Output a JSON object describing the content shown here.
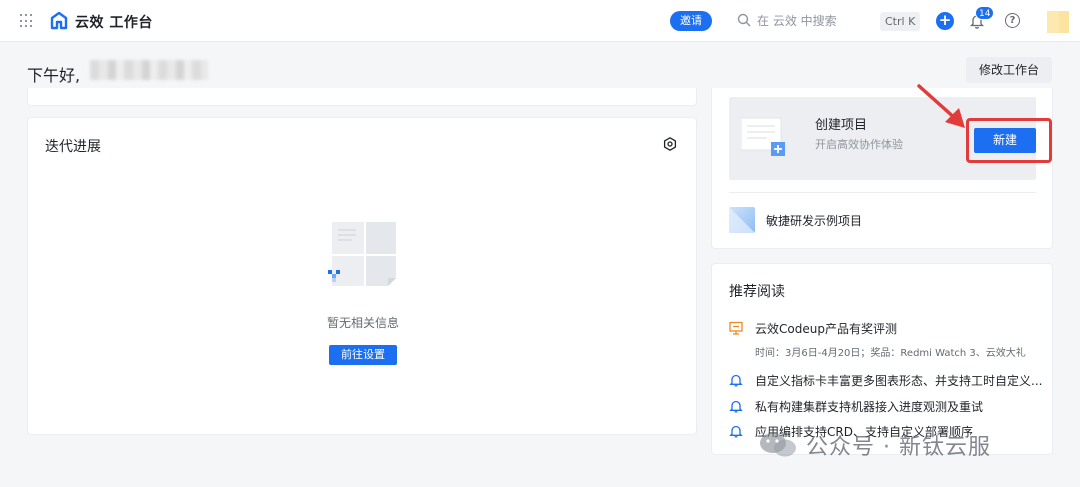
{
  "topbar": {
    "app_title": "云效 工作台",
    "invite_label": "邀请",
    "search_placeholder": "在 云效 中搜索",
    "shortcut": "Ctrl K",
    "notification_count": "14",
    "help_glyph": "?",
    "add_glyph": "+"
  },
  "greeting": {
    "text": "下午好,"
  },
  "edit_workbench_label": "修改工作台",
  "iteration_card": {
    "title": "迭代进展",
    "empty_text": "暂无相关信息",
    "goto_label": "前往设置"
  },
  "create_project": {
    "title": "创建项目",
    "subtitle": "开启高效协作体验",
    "new_label": "新建"
  },
  "sample_project": {
    "label": "敏捷研发示例项目"
  },
  "reading": {
    "title": "推荐阅读",
    "items": [
      {
        "text": "云效Codeup产品有奖评测",
        "meta": "时间：3月6日-4月20日；奖品：Redmi Watch 3、云效大礼",
        "icon": "present-icon"
      },
      {
        "text": "自定义指标卡丰富更多图表形态、并支持工时自定义...",
        "icon": "bell-icon"
      },
      {
        "text": "私有构建集群支持机器接入进度观测及重试",
        "icon": "bell-icon"
      },
      {
        "text": "应用编排支持CRD、支持自定义部署顺序",
        "icon": "bell-icon"
      }
    ]
  },
  "watermark": {
    "text": "公众号 · 新钛云服"
  },
  "colors": {
    "primary": "#1b6ff0",
    "highlight": "#e23b3b",
    "icon_orange": "#f08a24"
  }
}
